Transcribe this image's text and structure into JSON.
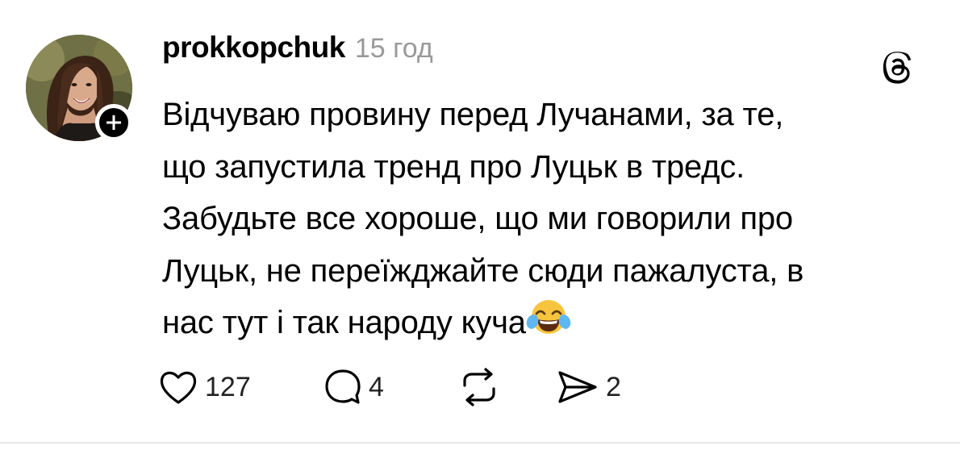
{
  "post": {
    "username": "prokkopchuk",
    "time": "15 год",
    "text_lines": [
      "Відчуваю провину перед Лучанами, за те,",
      "що запустила тренд про Луцьк в тредс.",
      "Забудьте все хороше, що ми говорили про",
      "Луцьк, не переїжджайте сюди пажалуста, в",
      "нас тут і так народу куча"
    ],
    "emoji": "face-with-tears-of-joy"
  },
  "actions": {
    "like_count": "127",
    "reply_count": "4",
    "share_count": "2"
  },
  "icons": {
    "like": "heart-icon",
    "reply": "speech-bubble-icon",
    "repost": "repost-icon",
    "share": "send-icon",
    "logo": "threads-logo",
    "follow": "plus-icon"
  },
  "colors": {
    "text": "#000000",
    "muted": "#9a9a9a",
    "background": "#ffffff"
  }
}
